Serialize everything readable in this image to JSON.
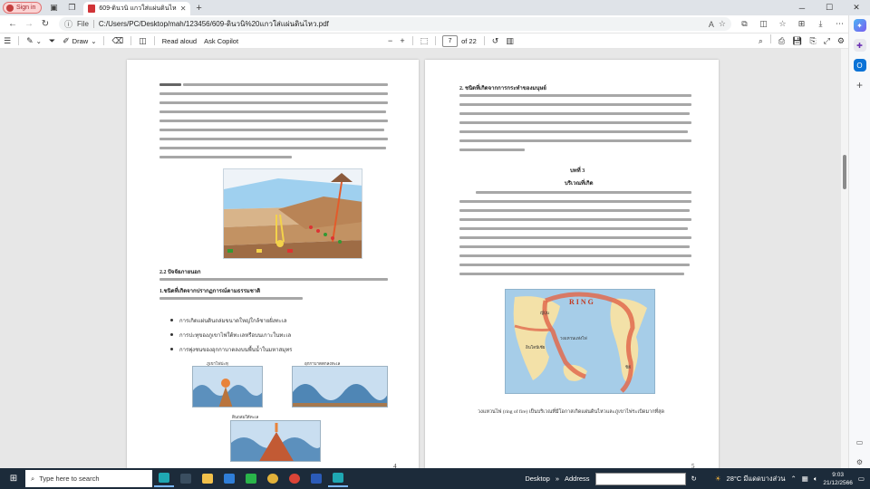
{
  "browser": {
    "signin_label": "Sign in",
    "tab_title": "609-ดินวนิ แกวใส่แผ่นดินไหว.pdf",
    "file_label": "File",
    "address": "C:/Users/PC/Desktop/mah/123456/609-ดินวนิ%20แกวใส่แผ่นดินไหว.pdf"
  },
  "pdf_toolbar": {
    "draw_label": "Draw",
    "read_aloud_label": "Read aloud",
    "ask_copilot_label": "Ask Copilot",
    "zoom_out": "−",
    "zoom_in": "+",
    "page_current": "7",
    "page_total": "of 22"
  },
  "document": {
    "left_page": {
      "section_heading": "2.2 ปัจจัยภายนอก",
      "subheading": "1.ชนิดที่เกิดจากปรากฏการณ์ตามธรรมชาติ",
      "bullets": [
        "การเกิดแผ่นดินถล่มขนาดใหญ่ใกล้ชายฝั่งทะเล",
        "การปะทุของภูเขาไฟใต้ทะเลหรือบนเกาะในทะเล",
        "การพุ่งชนของอุกกาบาตลงบนพื้นน้ำในมหาสมุทร"
      ],
      "figure_caption_1": "ภูเขาไฟปะทุ",
      "figure_caption_2": "อุกกาบาตตกลงทะเล",
      "figure_caption_3": "ดินถล่มใต้ทะเล",
      "page_number": "4"
    },
    "right_page": {
      "section_heading": "2. ชนิดที่เกิดจากการกระทำของมนุษย์",
      "chapter_label": "บทที่ 3",
      "chapter_title": "บริเวณที่เกิด",
      "map_label_1": "วงแหวนแห่งไฟ",
      "map_label_2": "ญี่ปุ่น",
      "map_label_3": "อินโดนีเซีย",
      "map_label_4": "ชิลี",
      "figure_caption": "วงแหวนไฟ (ring of fire) เป็นบริเวณที่มีโอกาสเกิดแผ่นดินไหวและภูเขาไฟระเบิดมากที่สุด",
      "page_number": "5"
    }
  },
  "taskbar": {
    "search_placeholder": "Type here to search",
    "desktop_label": "Desktop",
    "address_label": "Address",
    "weather": "28°C มีแดดบางส่วน",
    "time": "9:03",
    "date": "21/12/2566"
  },
  "colors": {
    "taskbar": "#1c2b3a",
    "tab_pdf": "#d13438",
    "signin_bg": "#fbd3d3"
  }
}
